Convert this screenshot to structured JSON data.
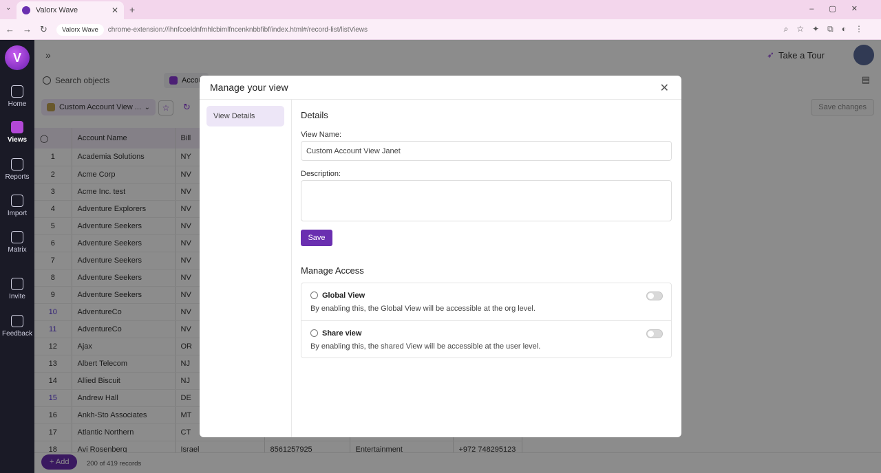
{
  "browser": {
    "tab_title": "Valorx Wave",
    "url_chip": "Valorx Wave",
    "url_path": "chrome-extension://ihnfcoeldnfmhlcbimlfncenknbbfibf/index.html#/record-list/listViews"
  },
  "rail": {
    "logo": "V",
    "items": [
      {
        "label": "Home",
        "icon": "home-icon"
      },
      {
        "label": "Views",
        "icon": "views-icon"
      },
      {
        "label": "Reports",
        "icon": "reports-icon"
      },
      {
        "label": "Import",
        "icon": "import-icon"
      },
      {
        "label": "Matrix",
        "icon": "matrix-icon"
      },
      {
        "label": "Invite",
        "icon": "invite-icon"
      },
      {
        "label": "Feedback",
        "icon": "feedback-icon"
      }
    ]
  },
  "topbar": {
    "tour_label": "Take a Tour"
  },
  "search": {
    "placeholder": "Search objects",
    "object_tab": "Accou"
  },
  "viewbar": {
    "current_view": "Custom Account View ...",
    "save_changes": "Save changes"
  },
  "grid": {
    "headers": [
      "Account Name",
      "Bill"
    ],
    "rows": [
      {
        "n": "1",
        "name": "Academia Solutions",
        "state": "NY"
      },
      {
        "n": "2",
        "name": "Acme Corp",
        "state": "NV"
      },
      {
        "n": "3",
        "name": "Acme Inc. test",
        "state": "NV"
      },
      {
        "n": "4",
        "name": "Adventure Explorers",
        "state": "NV"
      },
      {
        "n": "5",
        "name": "Adventure Seekers",
        "state": "NV"
      },
      {
        "n": "6",
        "name": "Adventure Seekers",
        "state": "NV"
      },
      {
        "n": "7",
        "name": "Adventure Seekers",
        "state": "NV"
      },
      {
        "n": "8",
        "name": "Adventure Seekers",
        "state": "NV"
      },
      {
        "n": "9",
        "name": "Adventure Seekers",
        "state": "NV"
      },
      {
        "n": "10",
        "name": "AdventureCo",
        "state": "NV"
      },
      {
        "n": "11",
        "name": "AdventureCo",
        "state": "NV"
      },
      {
        "n": "12",
        "name": "Ajax",
        "state": "OR"
      },
      {
        "n": "13",
        "name": "Albert Telecom",
        "state": "NJ"
      },
      {
        "n": "14",
        "name": "Allied Biscuit",
        "state": "NJ"
      },
      {
        "n": "15",
        "name": "Andrew Hall",
        "state": "DE"
      },
      {
        "n": "16",
        "name": "Ankh-Sto Associates",
        "state": "MT"
      },
      {
        "n": "17",
        "name": "Atlantic Northern",
        "state": "CT"
      },
      {
        "n": "18",
        "name": "Avi Rosenberg",
        "state": "Israel",
        "phone": "8561257925",
        "industry": "Entertainment",
        "mobile": "+972 748295123"
      }
    ]
  },
  "footer": {
    "add_label": "+ Add",
    "count": "200 of 419 records"
  },
  "modal": {
    "title": "Manage your view",
    "side_item": "View Details",
    "details_title": "Details",
    "view_name_label": "View Name:",
    "view_name_value": "Custom Account View Janet",
    "description_label": "Description:",
    "description_value": "",
    "save_label": "Save",
    "access_title": "Manage Access",
    "global_name": "Global View",
    "global_desc": "By enabling this, the Global View will be accessible at the org level.",
    "global_enabled": false,
    "share_name": "Share view",
    "share_desc": "By enabling this, the shared View will be accessible at the user level.",
    "share_enabled": false
  }
}
